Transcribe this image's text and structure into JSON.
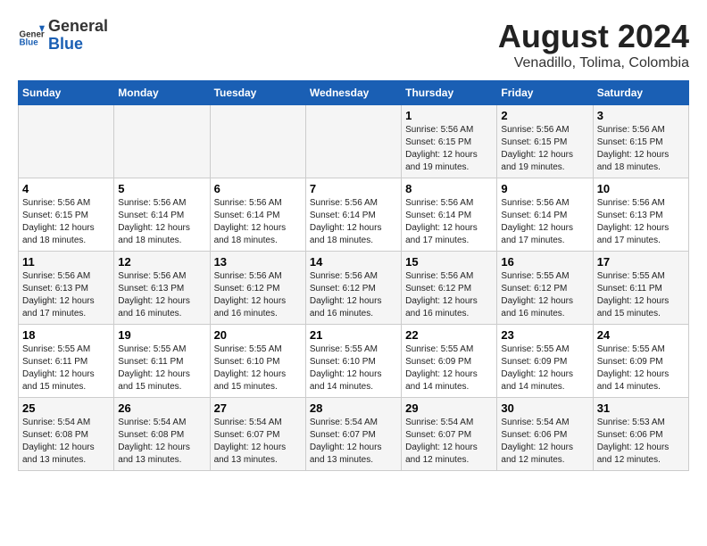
{
  "header": {
    "logo_general": "General",
    "logo_blue": "Blue",
    "title": "August 2024",
    "subtitle": "Venadillo, Tolima, Colombia"
  },
  "weekdays": [
    "Sunday",
    "Monday",
    "Tuesday",
    "Wednesday",
    "Thursday",
    "Friday",
    "Saturday"
  ],
  "weeks": [
    [
      {
        "day": "",
        "info": ""
      },
      {
        "day": "",
        "info": ""
      },
      {
        "day": "",
        "info": ""
      },
      {
        "day": "",
        "info": ""
      },
      {
        "day": "1",
        "info": "Sunrise: 5:56 AM\nSunset: 6:15 PM\nDaylight: 12 hours\nand 19 minutes."
      },
      {
        "day": "2",
        "info": "Sunrise: 5:56 AM\nSunset: 6:15 PM\nDaylight: 12 hours\nand 19 minutes."
      },
      {
        "day": "3",
        "info": "Sunrise: 5:56 AM\nSunset: 6:15 PM\nDaylight: 12 hours\nand 18 minutes."
      }
    ],
    [
      {
        "day": "4",
        "info": "Sunrise: 5:56 AM\nSunset: 6:15 PM\nDaylight: 12 hours\nand 18 minutes."
      },
      {
        "day": "5",
        "info": "Sunrise: 5:56 AM\nSunset: 6:14 PM\nDaylight: 12 hours\nand 18 minutes."
      },
      {
        "day": "6",
        "info": "Sunrise: 5:56 AM\nSunset: 6:14 PM\nDaylight: 12 hours\nand 18 minutes."
      },
      {
        "day": "7",
        "info": "Sunrise: 5:56 AM\nSunset: 6:14 PM\nDaylight: 12 hours\nand 18 minutes."
      },
      {
        "day": "8",
        "info": "Sunrise: 5:56 AM\nSunset: 6:14 PM\nDaylight: 12 hours\nand 17 minutes."
      },
      {
        "day": "9",
        "info": "Sunrise: 5:56 AM\nSunset: 6:14 PM\nDaylight: 12 hours\nand 17 minutes."
      },
      {
        "day": "10",
        "info": "Sunrise: 5:56 AM\nSunset: 6:13 PM\nDaylight: 12 hours\nand 17 minutes."
      }
    ],
    [
      {
        "day": "11",
        "info": "Sunrise: 5:56 AM\nSunset: 6:13 PM\nDaylight: 12 hours\nand 17 minutes."
      },
      {
        "day": "12",
        "info": "Sunrise: 5:56 AM\nSunset: 6:13 PM\nDaylight: 12 hours\nand 16 minutes."
      },
      {
        "day": "13",
        "info": "Sunrise: 5:56 AM\nSunset: 6:12 PM\nDaylight: 12 hours\nand 16 minutes."
      },
      {
        "day": "14",
        "info": "Sunrise: 5:56 AM\nSunset: 6:12 PM\nDaylight: 12 hours\nand 16 minutes."
      },
      {
        "day": "15",
        "info": "Sunrise: 5:56 AM\nSunset: 6:12 PM\nDaylight: 12 hours\nand 16 minutes."
      },
      {
        "day": "16",
        "info": "Sunrise: 5:55 AM\nSunset: 6:12 PM\nDaylight: 12 hours\nand 16 minutes."
      },
      {
        "day": "17",
        "info": "Sunrise: 5:55 AM\nSunset: 6:11 PM\nDaylight: 12 hours\nand 15 minutes."
      }
    ],
    [
      {
        "day": "18",
        "info": "Sunrise: 5:55 AM\nSunset: 6:11 PM\nDaylight: 12 hours\nand 15 minutes."
      },
      {
        "day": "19",
        "info": "Sunrise: 5:55 AM\nSunset: 6:11 PM\nDaylight: 12 hours\nand 15 minutes."
      },
      {
        "day": "20",
        "info": "Sunrise: 5:55 AM\nSunset: 6:10 PM\nDaylight: 12 hours\nand 15 minutes."
      },
      {
        "day": "21",
        "info": "Sunrise: 5:55 AM\nSunset: 6:10 PM\nDaylight: 12 hours\nand 14 minutes."
      },
      {
        "day": "22",
        "info": "Sunrise: 5:55 AM\nSunset: 6:09 PM\nDaylight: 12 hours\nand 14 minutes."
      },
      {
        "day": "23",
        "info": "Sunrise: 5:55 AM\nSunset: 6:09 PM\nDaylight: 12 hours\nand 14 minutes."
      },
      {
        "day": "24",
        "info": "Sunrise: 5:55 AM\nSunset: 6:09 PM\nDaylight: 12 hours\nand 14 minutes."
      }
    ],
    [
      {
        "day": "25",
        "info": "Sunrise: 5:54 AM\nSunset: 6:08 PM\nDaylight: 12 hours\nand 13 minutes."
      },
      {
        "day": "26",
        "info": "Sunrise: 5:54 AM\nSunset: 6:08 PM\nDaylight: 12 hours\nand 13 minutes."
      },
      {
        "day": "27",
        "info": "Sunrise: 5:54 AM\nSunset: 6:07 PM\nDaylight: 12 hours\nand 13 minutes."
      },
      {
        "day": "28",
        "info": "Sunrise: 5:54 AM\nSunset: 6:07 PM\nDaylight: 12 hours\nand 13 minutes."
      },
      {
        "day": "29",
        "info": "Sunrise: 5:54 AM\nSunset: 6:07 PM\nDaylight: 12 hours\nand 12 minutes."
      },
      {
        "day": "30",
        "info": "Sunrise: 5:54 AM\nSunset: 6:06 PM\nDaylight: 12 hours\nand 12 minutes."
      },
      {
        "day": "31",
        "info": "Sunrise: 5:53 AM\nSunset: 6:06 PM\nDaylight: 12 hours\nand 12 minutes."
      }
    ]
  ]
}
